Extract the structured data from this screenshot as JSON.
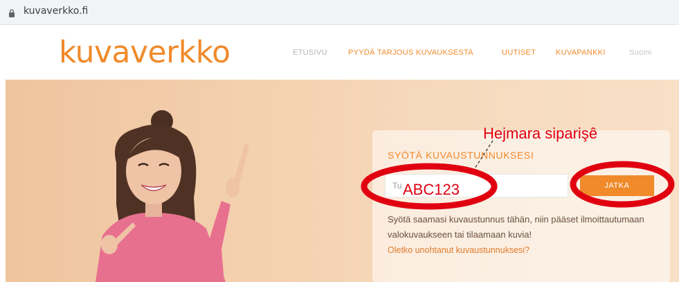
{
  "browser": {
    "url": "kuvaverkko.fi"
  },
  "header": {
    "logo_text": "kuvaverkko",
    "nav": [
      {
        "label": "ETUSIVU",
        "color": "#b3b3b3"
      },
      {
        "label": "PYYDÄ TARJOUS KUVAUKSESTA",
        "color": "#f08a2a"
      },
      {
        "label": "UUTISET",
        "color": "#f08a2a"
      },
      {
        "label": "KUVAPANKKI",
        "color": "#f08a2a"
      },
      {
        "label": "Suomi",
        "color": "#c6c6c6"
      }
    ]
  },
  "card": {
    "title": "SYÖTÄ KUVAUSTUNNUKSESI",
    "input_placeholder": "Tu",
    "button_label": "JATKA",
    "description": "Syötä saamasi kuvaustunnus tähän, niin pääset ilmoittautumaan valokuvaukseen tai tilaamaan kuvia!",
    "forgot_link": "Oletko unohtanut kuvaustunnuksesi?"
  },
  "annotations": {
    "order_number_label": "Hejmara siparişê",
    "example_code": "ABC123",
    "color": "#e00010"
  },
  "colors": {
    "brand": "#f08a2a"
  }
}
